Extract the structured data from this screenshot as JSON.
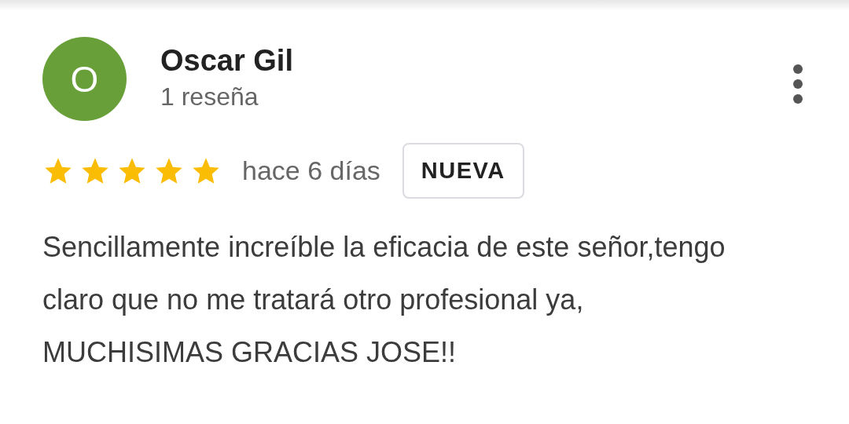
{
  "review": {
    "avatar_initial": "O",
    "name": "Oscar Gil",
    "review_count": "1 reseña",
    "stars": 5,
    "time": "hace 6 días",
    "badge": "NUEVA",
    "text": "Sencillamente increíble la eficacia de este señor,tengo claro que no me tratará otro profesional ya, MUCHISIMAS GRACIAS JOSE!!"
  }
}
